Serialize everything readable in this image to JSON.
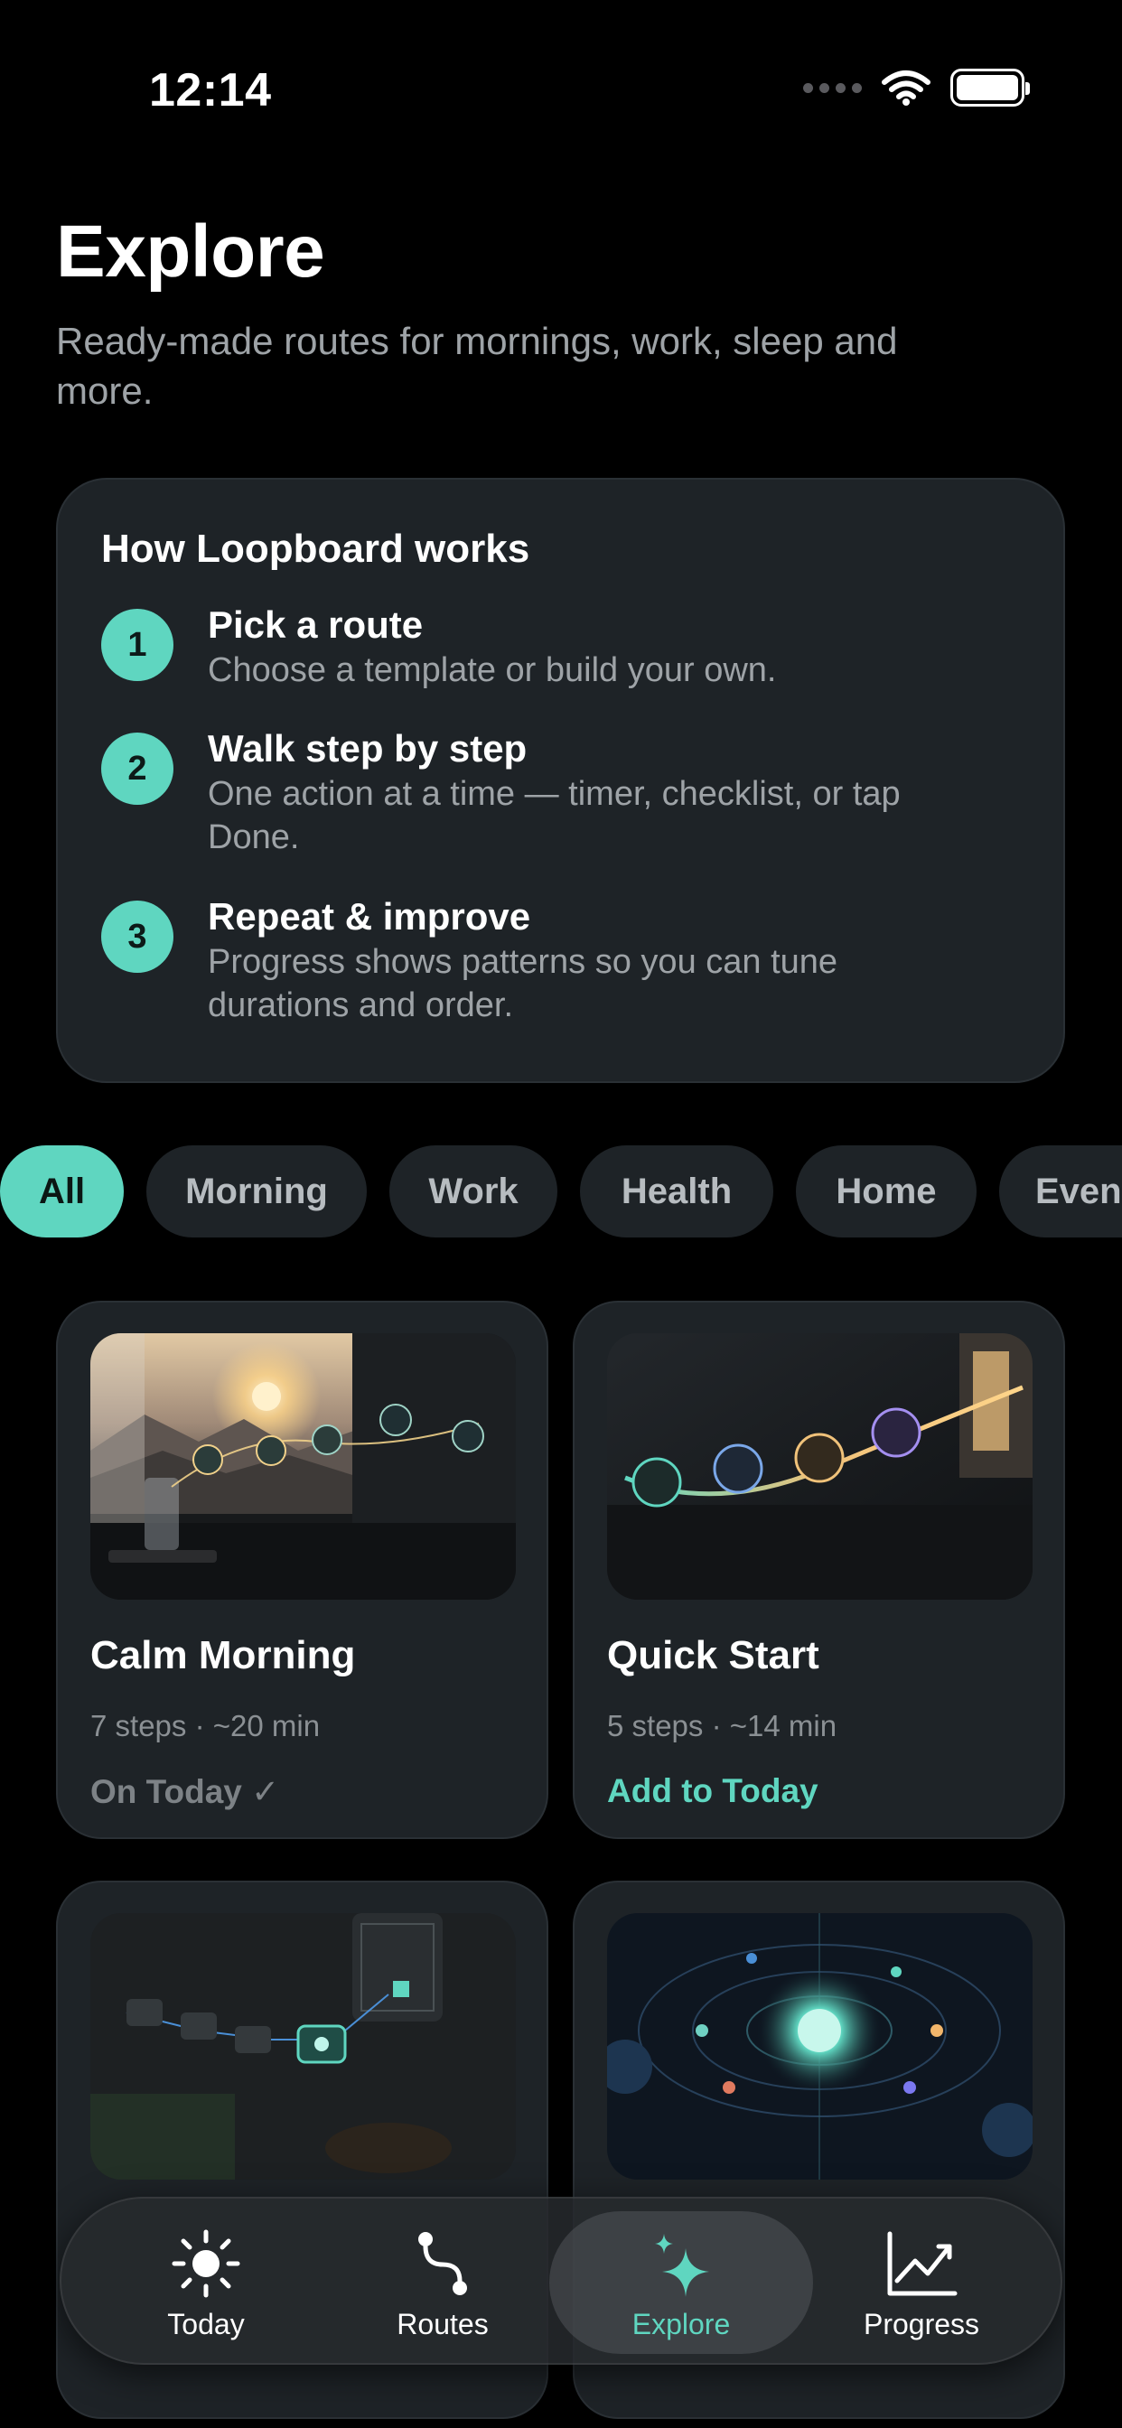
{
  "status_bar": {
    "time": "12:14"
  },
  "header": {
    "title": "Explore",
    "subtitle": "Ready-made routes for mornings, work, sleep and more."
  },
  "how_it_works": {
    "title": "How Loopboard works",
    "steps": [
      {
        "num": "1",
        "title": "Pick a route",
        "desc": "Choose a template or build your own."
      },
      {
        "num": "2",
        "title": "Walk step by step",
        "desc": "One action at a time — timer, checklist, or tap Done."
      },
      {
        "num": "3",
        "title": "Repeat & improve",
        "desc": "Progress shows patterns so you can tune durations and order."
      }
    ]
  },
  "filters": {
    "selected": "All",
    "chips": [
      "All",
      "Morning",
      "Work",
      "Health",
      "Home",
      "Even"
    ]
  },
  "routes": [
    {
      "name": "Calm Morning",
      "meta": "7 steps · ~20 min",
      "action": "On Today ✓",
      "added": true
    },
    {
      "name": "Quick Start",
      "meta": "5 steps · ~14 min",
      "action": "Add to Today",
      "added": false
    },
    {
      "name": "",
      "meta": "",
      "action": "",
      "added": true
    },
    {
      "name": "",
      "meta": "",
      "action": "",
      "added": false
    }
  ],
  "tab_bar": {
    "active": "Explore",
    "tabs": [
      {
        "label": "Today",
        "icon": "sun-icon"
      },
      {
        "label": "Routes",
        "icon": "route-icon"
      },
      {
        "label": "Explore",
        "icon": "sparkles-icon"
      },
      {
        "label": "Progress",
        "icon": "chart-trend-icon"
      }
    ]
  },
  "colors": {
    "accent": "#5fd6c0",
    "background": "#000000",
    "card": "#1e2327",
    "secondary_text": "#9ea3a7"
  }
}
